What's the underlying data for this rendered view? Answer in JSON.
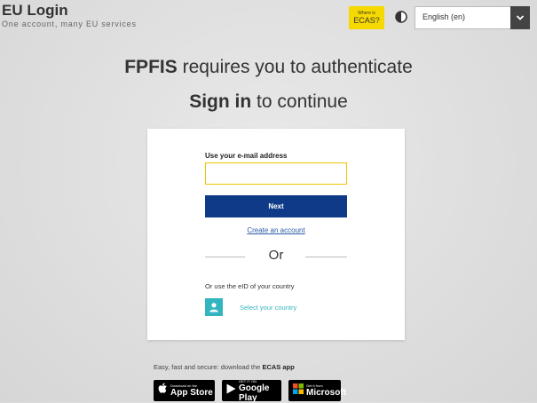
{
  "header": {
    "brand_title": "EU Login",
    "brand_subtitle": "One account, many EU services",
    "where_small": "Where is",
    "where_big": "ECAS?",
    "language": "English (en)"
  },
  "main": {
    "heading1_bold": "FPFIS",
    "heading1_rest": " requires you to authenticate",
    "heading2_bold": "Sign in",
    "heading2_rest": " to continue"
  },
  "card": {
    "email_label": "Use your e-mail address",
    "email_value": "",
    "next_label": "Next",
    "create_account": "Create an account",
    "or": "Or",
    "eid_label": "Or use the eID of your country",
    "select_country": "Select your country"
  },
  "footer": {
    "download_prefix": "Easy, fast and secure: download the ",
    "download_app": "ECAS app",
    "stores": [
      {
        "small": "Download on the",
        "big": "App Store"
      },
      {
        "small": "GET IT ON",
        "big": "Google Play"
      },
      {
        "small": "Get it from",
        "big": "Microsoft"
      }
    ]
  },
  "colors": {
    "accent_blue": "#0e3a87",
    "highlight_yellow": "#f6d900",
    "teal": "#33b5bf"
  }
}
